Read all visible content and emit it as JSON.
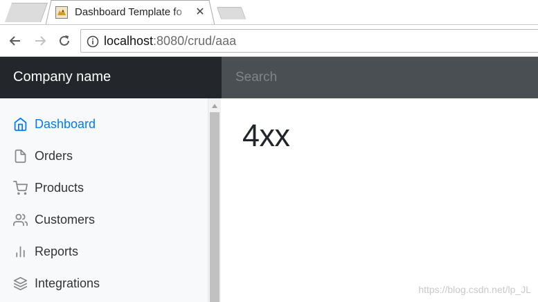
{
  "browser": {
    "tabs": [
      {
        "title": "",
        "state": "inactive"
      },
      {
        "title": "Dashboard Template fo",
        "state": "active",
        "icon": "tomcat-icon"
      }
    ],
    "close_glyph": "✕",
    "address": {
      "host": "localhost",
      "rest": ":8080/crud/aaa"
    },
    "icons": {
      "back": "arrow-left-icon",
      "forward": "arrow-right-icon",
      "reload": "reload-icon",
      "info": "info-icon"
    }
  },
  "navbar": {
    "brand": "Company name",
    "search_placeholder": "Search"
  },
  "sidebar": {
    "items": [
      {
        "label": "Dashboard",
        "icon": "home-icon",
        "active": true
      },
      {
        "label": "Orders",
        "icon": "file-icon",
        "active": false
      },
      {
        "label": "Products",
        "icon": "shopping-cart-icon",
        "active": false
      },
      {
        "label": "Customers",
        "icon": "users-icon",
        "active": false
      },
      {
        "label": "Reports",
        "icon": "bar-chart-icon",
        "active": false
      },
      {
        "label": "Integrations",
        "icon": "layers-icon",
        "active": false
      }
    ]
  },
  "main": {
    "heading": "4xx"
  },
  "watermark": "https://blog.csdn.net/lp_JL",
  "colors": {
    "navbar_bg": "#343a40",
    "brand_bg": "#23272b",
    "active_link": "#007bff",
    "sidebar_bg": "#f8f9fa"
  }
}
